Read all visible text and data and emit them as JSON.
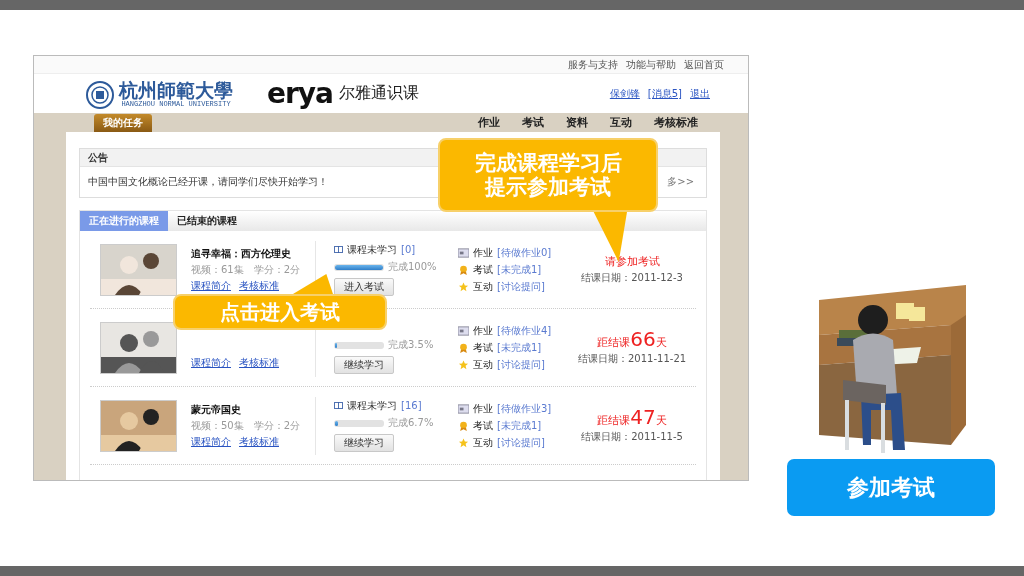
{
  "site": {
    "top_links": [
      "服务与支持",
      "功能与帮助",
      "返回首页"
    ],
    "school_name": "杭州師範大學",
    "school_name_en": "HANGZHOU NORMAL UNIVERSITY",
    "brand": "erya",
    "brand_name": "尔雅通识课",
    "user_links": [
      "保剑锋",
      "[消息5]",
      "退出"
    ],
    "home_tab": "我的任务",
    "nav": [
      "作业",
      "考试",
      "资料",
      "互动",
      "考核标准"
    ],
    "notice": {
      "title": "公告",
      "text": "中国中国文化概论已经开课，请同学们尽快开始学习！",
      "more": "多>>"
    },
    "tabs": [
      {
        "label": "正在进行的课程",
        "selected": true
      },
      {
        "label": "已结束的课程",
        "selected": false
      }
    ],
    "courses": [
      {
        "title": "追寻幸福：西方伦理史",
        "meta": "视频：61集　学分：2分",
        "links": [
          "课程简介",
          "考核标准"
        ],
        "progress_label": "课程未学习",
        "progress_count": "[0]",
        "level": 1.0,
        "percent": "完成100%",
        "button": "进入考试",
        "tasks": [
          {
            "kind": "homework",
            "label": "作业",
            "value": "[待做作业0]"
          },
          {
            "kind": "exam",
            "label": "考试",
            "value": "[未完成1]"
          },
          {
            "kind": "discuss",
            "label": "互动",
            "value": "[讨论提问]"
          }
        ],
        "status": {
          "kind": "exam",
          "text": "请参加考试"
        },
        "end_date": "结课日期：2011-12-3"
      },
      {
        "links": [
          "课程简介",
          "考核标准"
        ],
        "level": 0.035,
        "percent": "完成3.5%",
        "button": "继续学习",
        "tasks": [
          {
            "kind": "homework",
            "label": "作业",
            "value": "[待做作业4]"
          },
          {
            "kind": "exam",
            "label": "考试",
            "value": "[未完成1]"
          },
          {
            "kind": "discuss",
            "label": "互动",
            "value": "[讨论提问]"
          }
        ],
        "status": {
          "kind": "countdown",
          "prefix": "距结课",
          "number": "66",
          "suffix": "天"
        },
        "end_date": "结课日期：2011-11-21"
      },
      {
        "title": "蒙元帝国史",
        "meta": "视频：50集　学分：2分",
        "links": [
          "课程简介",
          "考核标准"
        ],
        "progress_label": "课程未学习",
        "progress_count": "[16]",
        "level": 0.067,
        "percent": "完成6.7%",
        "button": "继续学习",
        "tasks": [
          {
            "kind": "homework",
            "label": "作业",
            "value": "[待做作业3]"
          },
          {
            "kind": "exam",
            "label": "考试",
            "value": "[未完成1]"
          },
          {
            "kind": "discuss",
            "label": "互动",
            "value": "[讨论提问]"
          }
        ],
        "status": {
          "kind": "countdown",
          "prefix": "距结课",
          "number": "47",
          "suffix": "天"
        },
        "end_date": "结课日期：2011-11-5"
      }
    ]
  },
  "callouts": [
    {
      "kind": "top",
      "lines": [
        "完成课程学习后",
        "提示参加考试"
      ]
    },
    {
      "kind": "side",
      "lines": [
        "点击进入考试"
      ]
    }
  ],
  "action_button": "参加考试"
}
